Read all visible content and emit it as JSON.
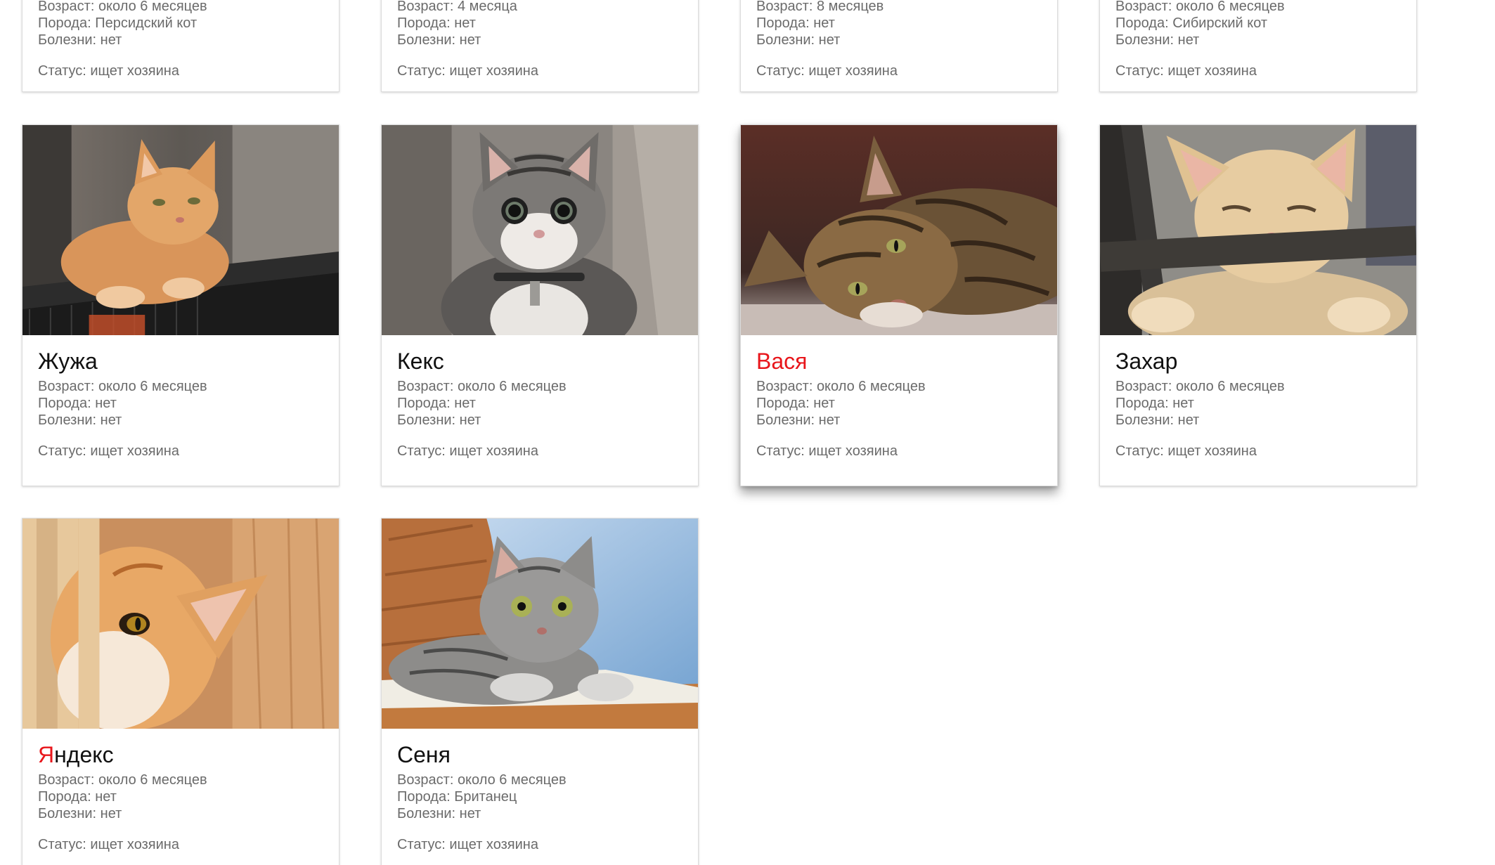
{
  "labels": {
    "age": "Возраст: ",
    "breed": "Порода: ",
    "illness": "Болезни: ",
    "status": "Статус: "
  },
  "top_row": [
    {
      "age": "около 6 месяцев",
      "breed": "Персидский кот",
      "illness": "нет",
      "status": "ищет хозяина"
    },
    {
      "age": "4 месяца",
      "breed": "нет",
      "illness": "нет",
      "status": "ищет хозяина"
    },
    {
      "age": "8 месяцев",
      "breed": "нет",
      "illness": "нет",
      "status": "ищет хозяина"
    },
    {
      "age": "около 6 месяцев",
      "breed": "Сибирский кот",
      "illness": "нет",
      "status": "ищет хозяина"
    }
  ],
  "cats": [
    {
      "name": "Жужа",
      "age": "около 6 месяцев",
      "breed": "нет",
      "illness": "нет",
      "status": "ищет хозяина",
      "photo": "ginger-cat-on-metal-mesh",
      "hovered": false
    },
    {
      "name": "Кекс",
      "age": "около 6 месяцев",
      "breed": "нет",
      "illness": "нет",
      "status": "ищет хозяина",
      "photo": "tabby-kitten-with-collar",
      "hovered": false
    },
    {
      "name": "Вася",
      "age": "около 6 месяцев",
      "breed": "нет",
      "illness": "нет",
      "status": "ищет хозяина",
      "photo": "brown-tabby-cat-lying",
      "hovered": true
    },
    {
      "name": "Захар",
      "age": "около 6 месяцев",
      "breed": "нет",
      "illness": "нет",
      "status": "ищет хозяина",
      "photo": "cream-cat-on-branch",
      "hovered": false
    },
    {
      "name_accent": "Я",
      "name_rest": "ндекс",
      "age": "около 6 месяцев",
      "breed": "нет",
      "illness": "нет",
      "status": "ищет хозяина",
      "photo": "ginger-cat-peeking",
      "hovered": false
    },
    {
      "name": "Сеня",
      "age": "около 6 месяцев",
      "breed": "Британец",
      "illness": "нет",
      "status": "ищет хозяина",
      "photo": "silver-british-cat",
      "hovered": false
    }
  ],
  "colors": {
    "accent_red": "#e8161b",
    "text_gray": "#6b6b6b",
    "name_black": "#111111"
  }
}
